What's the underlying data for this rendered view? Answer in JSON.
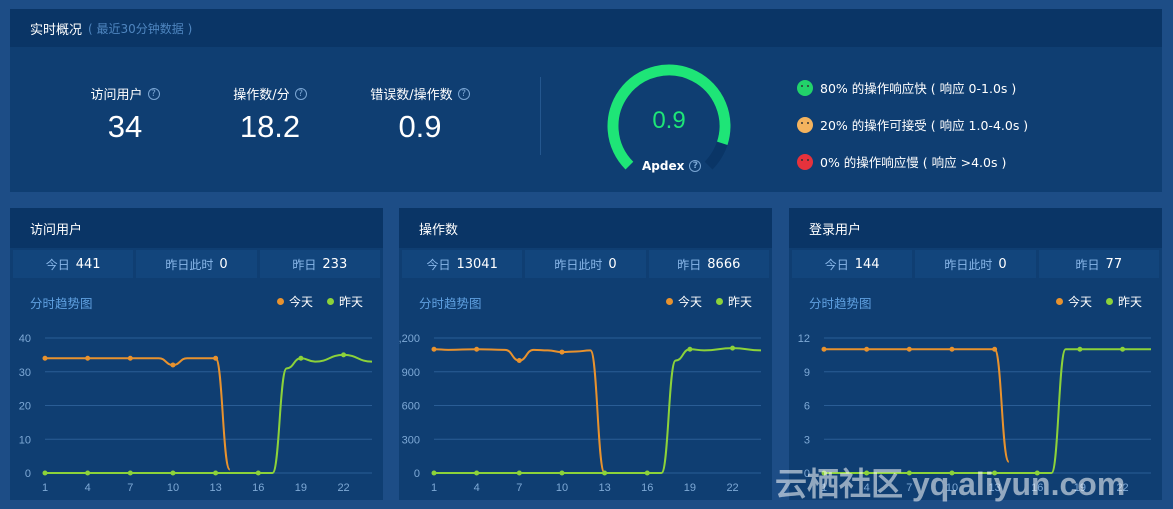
{
  "overview": {
    "title": "实时概况",
    "subtitle": "( 最近30分钟数据 )",
    "metrics": [
      {
        "label": "访问用户",
        "value": "34"
      },
      {
        "label": "操作数/分",
        "value": "18.2"
      },
      {
        "label": "错误数/操作数",
        "value": "0.9"
      }
    ],
    "apdex": {
      "value": "0.9",
      "label": "Apdex",
      "fraction": 0.9,
      "color": "#1ee577"
    },
    "legend": [
      {
        "text": "80% 的操作响应快 ( 响应 0-1.0s )",
        "color": "#22d36a",
        "icon": "happy-face-icon"
      },
      {
        "text": "20% 的操作可接受 ( 响应 1.0-4.0s )",
        "color": "#f4b35e",
        "icon": "neutral-face-icon"
      },
      {
        "text": "0% 的操作响应慢 ( 响应 >4.0s )",
        "color": "#e6323c",
        "icon": "sad-face-icon"
      }
    ]
  },
  "panels": [
    {
      "title": "访问用户",
      "stats": [
        {
          "key": "今日",
          "value": "441"
        },
        {
          "key": "昨日此时",
          "value": "0"
        },
        {
          "key": "昨日",
          "value": "233"
        }
      ],
      "trend_title": "分时趋势图",
      "legend_today": "今天",
      "legend_yesterday": "昨天"
    },
    {
      "title": "操作数",
      "stats": [
        {
          "key": "今日",
          "value": "13041"
        },
        {
          "key": "昨日此时",
          "value": "0"
        },
        {
          "key": "昨日",
          "value": "8666"
        }
      ],
      "trend_title": "分时趋势图",
      "legend_today": "今天",
      "legend_yesterday": "昨天"
    },
    {
      "title": "登录用户",
      "stats": [
        {
          "key": "今日",
          "value": "144"
        },
        {
          "key": "昨日此时",
          "value": "0"
        },
        {
          "key": "昨日",
          "value": "77"
        }
      ],
      "trend_title": "分时趋势图",
      "legend_today": "今天",
      "legend_yesterday": "昨天"
    }
  ],
  "colors": {
    "today": "#e8922e",
    "yesterday": "#8cd23a"
  },
  "watermark": "云栖社区 yq.aliyun.com",
  "chart_data": [
    {
      "type": "line",
      "x": [
        1,
        4,
        7,
        10,
        13,
        14,
        16,
        17,
        18,
        19,
        20,
        22,
        24
      ],
      "xticks": [
        1,
        4,
        7,
        10,
        13,
        16,
        19,
        22
      ],
      "yticks": [
        "0",
        "10",
        "20",
        "30",
        "40"
      ],
      "ylim": [
        0,
        40
      ],
      "series": [
        {
          "name": "今天",
          "x": [
            1,
            4,
            7,
            9,
            10,
            11,
            13,
            14
          ],
          "values": [
            34,
            34,
            34,
            34,
            32,
            34,
            34,
            1
          ]
        },
        {
          "name": "昨天",
          "x": [
            1,
            4,
            7,
            10,
            13,
            16,
            17,
            18,
            19,
            20,
            22,
            24
          ],
          "values": [
            0,
            0,
            0,
            0,
            0,
            0,
            0,
            31,
            34,
            33,
            35,
            33
          ]
        }
      ]
    },
    {
      "type": "line",
      "x": [
        1,
        4,
        7,
        10,
        13,
        16,
        19,
        22,
        24
      ],
      "xticks": [
        1,
        4,
        7,
        10,
        13,
        16,
        19,
        22
      ],
      "yticks": [
        "0",
        "300",
        "600",
        "900",
        "1,200"
      ],
      "ylim": [
        0,
        1200
      ],
      "series": [
        {
          "name": "今天",
          "x": [
            1,
            2,
            4,
            6,
            7,
            8,
            9,
            10,
            11,
            12,
            13
          ],
          "values": [
            1100,
            1095,
            1100,
            1095,
            1000,
            1095,
            1090,
            1075,
            1080,
            1090,
            0
          ]
        },
        {
          "name": "昨天",
          "x": [
            1,
            4,
            7,
            10,
            13,
            16,
            17,
            18,
            19,
            20,
            22,
            24
          ],
          "values": [
            0,
            0,
            0,
            0,
            0,
            0,
            0,
            1000,
            1100,
            1090,
            1110,
            1090
          ]
        }
      ]
    },
    {
      "type": "line",
      "x": [
        1,
        4,
        7,
        10,
        13,
        16,
        19,
        22,
        24
      ],
      "xticks": [
        1,
        4,
        7,
        10,
        13,
        16,
        19,
        22
      ],
      "yticks": [
        "0",
        "3",
        "6",
        "9",
        "12"
      ],
      "ylim": [
        0,
        12
      ],
      "series": [
        {
          "name": "今天",
          "x": [
            1,
            4,
            7,
            10,
            13,
            14
          ],
          "values": [
            11,
            11,
            11,
            11,
            11,
            1
          ]
        },
        {
          "name": "昨天",
          "x": [
            1,
            4,
            7,
            10,
            13,
            16,
            17,
            18,
            19,
            22,
            24
          ],
          "values": [
            0,
            0,
            0,
            0,
            0,
            0,
            0,
            11,
            11,
            11,
            11
          ]
        }
      ]
    }
  ]
}
